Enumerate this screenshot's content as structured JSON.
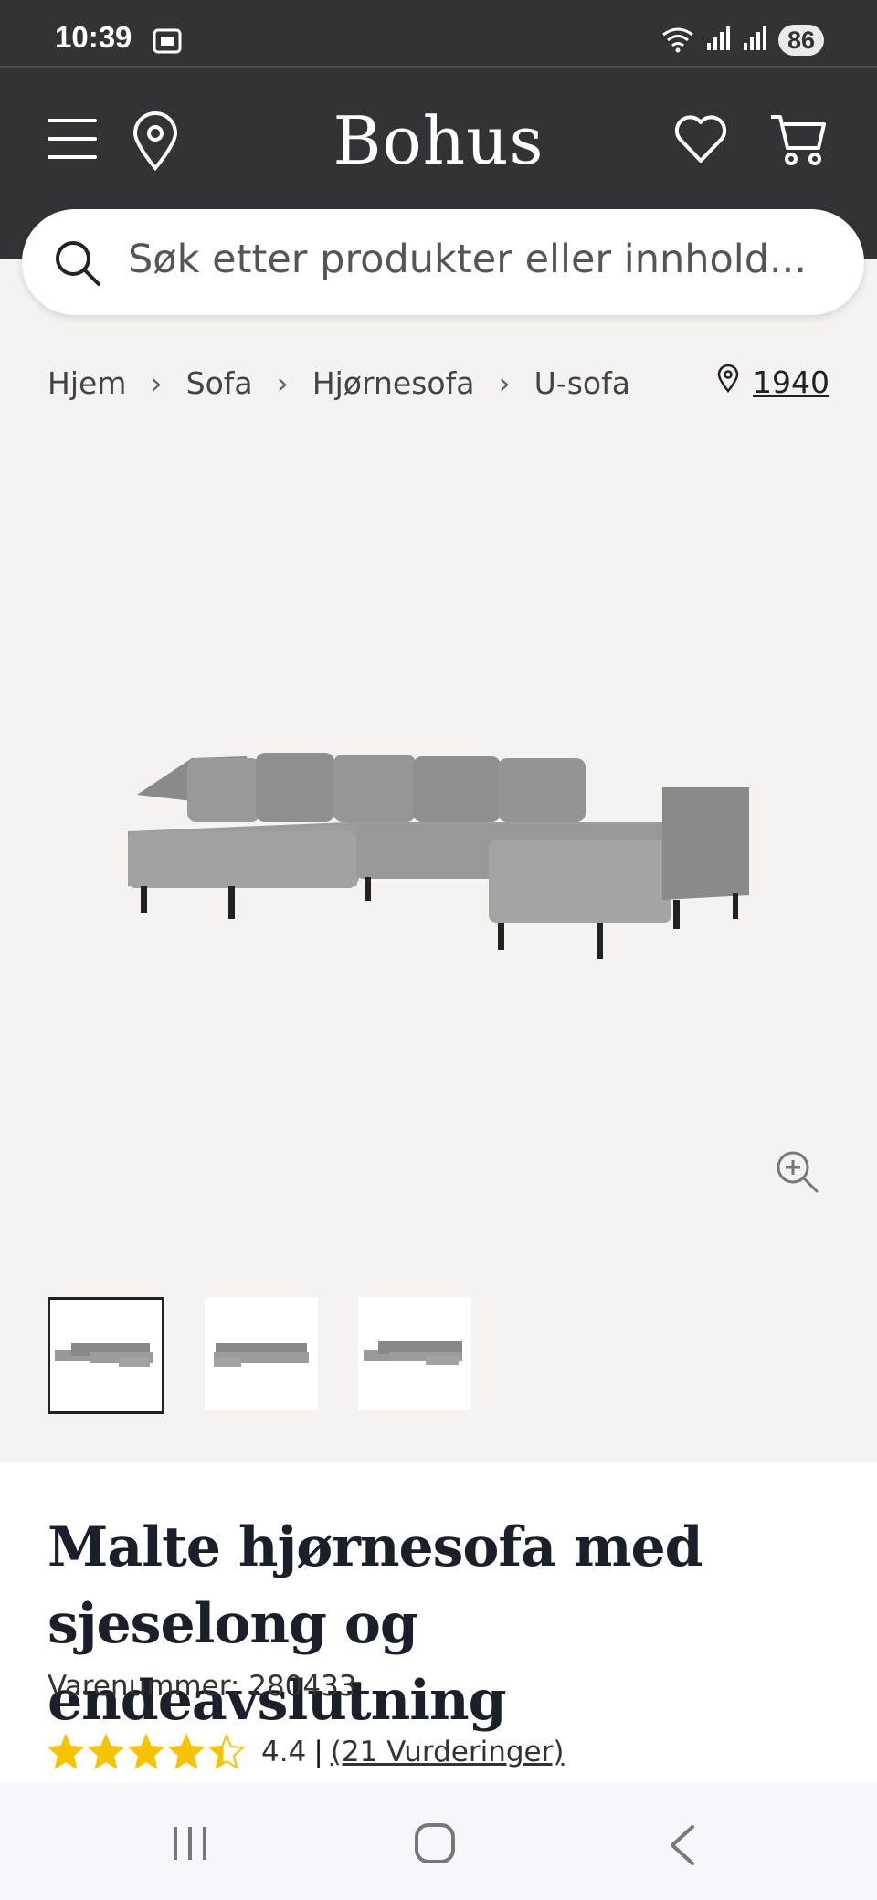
{
  "status_bar": {
    "time": "10:39",
    "battery": "86"
  },
  "header": {
    "logo": "Bohus"
  },
  "search": {
    "placeholder": "Søk etter produkter eller innhold..."
  },
  "breadcrumb": [
    "Hjem",
    "Sofa",
    "Hjørnesofa",
    "U-sofa"
  ],
  "store": {
    "number": "1940"
  },
  "product": {
    "title": "Malte hjørnesofa med sjeselong og endeavslutning",
    "sku": "Varenummer: 280433",
    "rating_value": "4.4",
    "rating_stars": 4.4,
    "reviews": "(21 Vurderinger)"
  },
  "colors": {
    "header_bg": "#333336",
    "page_bg": "#f4f3f1",
    "star": "#f5c400",
    "sofa": "#8e8e8e"
  },
  "icons": [
    "menu-icon",
    "location-pin-icon",
    "heart-icon",
    "cart-icon",
    "search-icon",
    "zoom-in-icon",
    "star-icon"
  ]
}
